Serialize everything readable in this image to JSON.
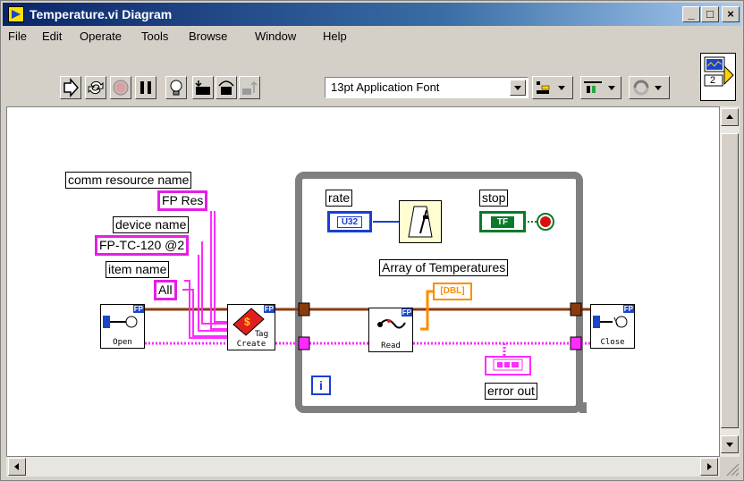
{
  "window": {
    "title": "Temperature.vi Diagram",
    "caption_buttons": {
      "minimize": "_",
      "maximize": "□",
      "close": "×"
    }
  },
  "menu": [
    "File",
    "Edit",
    "Operate",
    "Tools",
    "Browse",
    "Window",
    "Help"
  ],
  "toolbar": {
    "buttons": [
      "run-arrow",
      "run-continuously",
      "abort",
      "pause",
      "highlight-execution",
      "step-into",
      "step-over",
      "step-out"
    ],
    "font_select": "13pt Application Font",
    "extra_dropdowns": [
      "align",
      "distribute",
      "reorder"
    ]
  },
  "connector_icon_label": "2",
  "diagram": {
    "labels": {
      "comm_resource_name": "comm resource name",
      "device_name": "device name",
      "item_name": "item name",
      "rate": "rate",
      "stop": "stop",
      "array_of_temperatures": "Array of Temperatures",
      "error_out": "error out"
    },
    "constants": {
      "fp_res": "FP Res",
      "device": "FP-TC-120 @2",
      "item": "All"
    },
    "terminals": {
      "rate_type": "U32",
      "stop_type": "TF",
      "array_type": "[DBL]",
      "iteration": "i"
    },
    "subvis": {
      "open": "Open",
      "create": "Create",
      "tag": "Tag",
      "read": "Read",
      "close": "Close",
      "fp": "FP"
    }
  },
  "colors": {
    "string_wire": "#ff2bff",
    "refnum_wire": "#8a3a0f",
    "numeric_wire": "#1a3fd1",
    "array_wire": "#ff8c00",
    "boolean_wire": "#0b7a2a",
    "while_loop": "#7f7f7f"
  }
}
